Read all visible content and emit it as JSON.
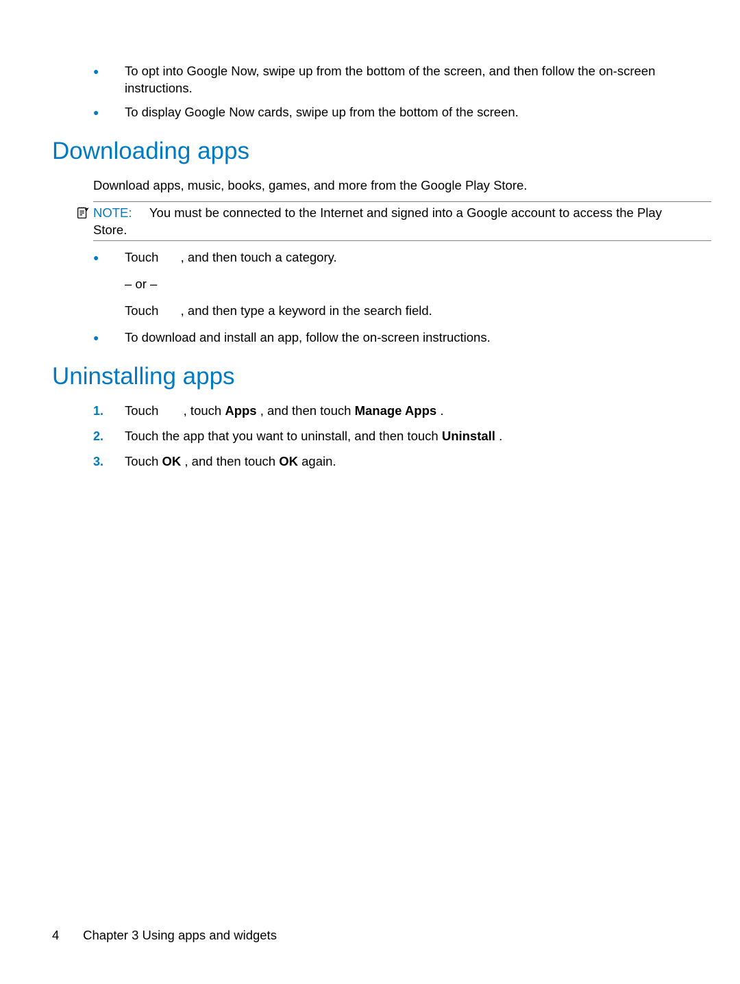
{
  "intro_bullets": [
    "To opt into Google Now, swipe up from the bottom of the screen, and then follow the on-screen instructions.",
    "To display Google Now cards, swipe up from the bottom of the screen."
  ],
  "section_downloading": {
    "heading": "Downloading apps",
    "intro": "Download apps, music, books, games, and more from the Google Play Store.",
    "note_label": "NOTE:",
    "note_text": "You must be connected to the Internet and signed into a Google account to access the Play Store.",
    "bullets": {
      "b1_prefix": "Touch ",
      "b1_suffix": ", and then touch a category.",
      "or_text": "– or –",
      "b1_alt_prefix": "Touch ",
      "b1_alt_suffix": ", and then type a keyword in the search field.",
      "b2": "To download and install an app, follow the on-screen instructions."
    }
  },
  "section_uninstalling": {
    "heading": "Uninstalling apps",
    "steps": {
      "n1": "1.",
      "s1_prefix": "Touch ",
      "s1_mid1": ", touch ",
      "s1_bold1": "Apps",
      "s1_mid2": ", and then touch ",
      "s1_bold2": "Manage Apps",
      "s1_end": ".",
      "n2": "2.",
      "s2_prefix": "Touch the app that you want to uninstall, and then touch ",
      "s2_bold": "Uninstall",
      "s2_end": ".",
      "n3": "3.",
      "s3_prefix": "Touch ",
      "s3_bold1": "OK",
      "s3_mid": ", and then touch ",
      "s3_bold2": "OK",
      "s3_end": " again."
    }
  },
  "footer": {
    "page_number": "4",
    "chapter_text": "Chapter 3   Using apps and widgets"
  }
}
